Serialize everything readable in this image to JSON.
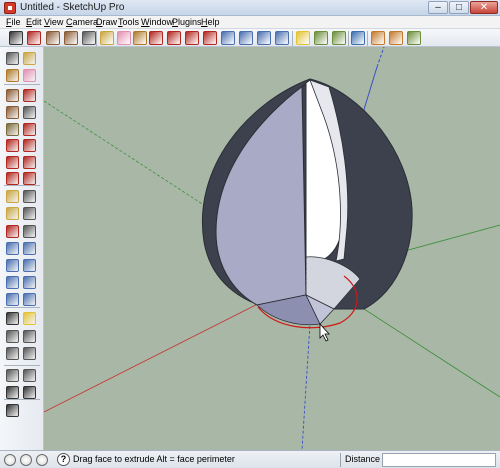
{
  "window": {
    "title": "Untitled - SketchUp Pro",
    "minimize_glyph": "–",
    "maximize_glyph": "□",
    "close_glyph": "✕"
  },
  "menu": [
    {
      "label": "File",
      "id": "file"
    },
    {
      "label": "Edit",
      "id": "edit"
    },
    {
      "label": "View",
      "id": "view"
    },
    {
      "label": "Camera",
      "id": "camera"
    },
    {
      "label": "Draw",
      "id": "draw"
    },
    {
      "label": "Tools",
      "id": "tools"
    },
    {
      "label": "Window",
      "id": "window"
    },
    {
      "label": "Plugins",
      "id": "plugins"
    },
    {
      "label": "Help",
      "id": "help"
    }
  ],
  "toolbar_icons": [
    {
      "name": "select-icon",
      "color": "#333333"
    },
    {
      "name": "pencil-icon",
      "color": "#b3261e"
    },
    {
      "name": "rectangle-icon",
      "color": "#8a5a34"
    },
    {
      "name": "circle-icon",
      "color": "#8a5a34"
    },
    {
      "name": "arc-icon",
      "color": "#555555"
    },
    {
      "name": "make-component-icon",
      "color": "#c9a640"
    },
    {
      "name": "eraser-icon",
      "color": "#e38fb0"
    },
    {
      "name": "paint-bucket-icon",
      "color": "#b07a2a"
    },
    {
      "name": "push-pull-icon",
      "color": "#b3261e"
    },
    {
      "name": "move-icon",
      "color": "#b3261e"
    },
    {
      "name": "rotate-icon",
      "color": "#b3261e"
    },
    {
      "name": "follow-me-icon",
      "color": "#b3261e"
    },
    {
      "name": "offset-icon",
      "color": "#4a6fb0"
    },
    {
      "name": "orbit-icon",
      "color": "#4a6fb0"
    },
    {
      "name": "zoom-icon",
      "color": "#4a6fb0"
    },
    {
      "name": "zoom-extents-icon",
      "color": "#4a6fb0"
    },
    {
      "name": "section-plane-icon",
      "color": "#e2c334"
    },
    {
      "name": "3d-warehouse-icon",
      "color": "#6b8e3a"
    },
    {
      "name": "share-model-icon",
      "color": "#6b8e3a"
    },
    {
      "name": "components-icon",
      "color": "#3d6fb0"
    },
    {
      "name": "extension-icon",
      "color": "#c37a2b"
    },
    {
      "name": "photo-textures-icon",
      "color": "#c37a2b"
    },
    {
      "name": "styles-icon",
      "color": "#6b8e3a"
    }
  ],
  "left_icons": [
    "select-icon",
    "make-component-icon",
    "paint-bucket-icon",
    "eraser-icon",
    "rectangle-icon",
    "line-icon",
    "circle-icon",
    "arc-icon",
    "polygon-icon",
    "freehand-icon",
    "move-icon",
    "push-pull-icon",
    "rotate-icon",
    "follow-me-icon",
    "scale-icon",
    "offset-icon",
    "tape-measure-icon",
    "dimension-icon",
    "protractor-icon",
    "text-icon",
    "axes-icon",
    "3d-text-icon",
    "orbit-icon",
    "pan-icon",
    "zoom-icon",
    "zoom-window-icon",
    "zoom-extents-icon",
    "previous-view-icon",
    "position-camera-icon",
    "look-around-icon",
    "walk-icon",
    "section-plane-icon",
    "iso-view-icon",
    "top-view-icon",
    "front-view-icon",
    "right-view-icon",
    "back-view-icon",
    "left-view-icon",
    "walk-footprints-icon",
    "position-camera-eye-icon",
    "look-around-eye-icon"
  ],
  "status": {
    "geo_icon": "geolocation-icon",
    "credits_icon": "credits-icon",
    "user_icon": "user-icon",
    "help_glyph": "?",
    "message": "Drag face to extrude  Alt = face perimeter",
    "measure_label": "Distance",
    "measure_value": ""
  },
  "colors": {
    "viewport_bg": "#a9b8a6",
    "shell_dark": "#3d414d",
    "face_front": "#a9abc6",
    "face_inner": "#ffffff",
    "axis_red": "#c23a3a",
    "axis_green": "#3e8e3e",
    "axis_blue": "#3a4fc4"
  }
}
